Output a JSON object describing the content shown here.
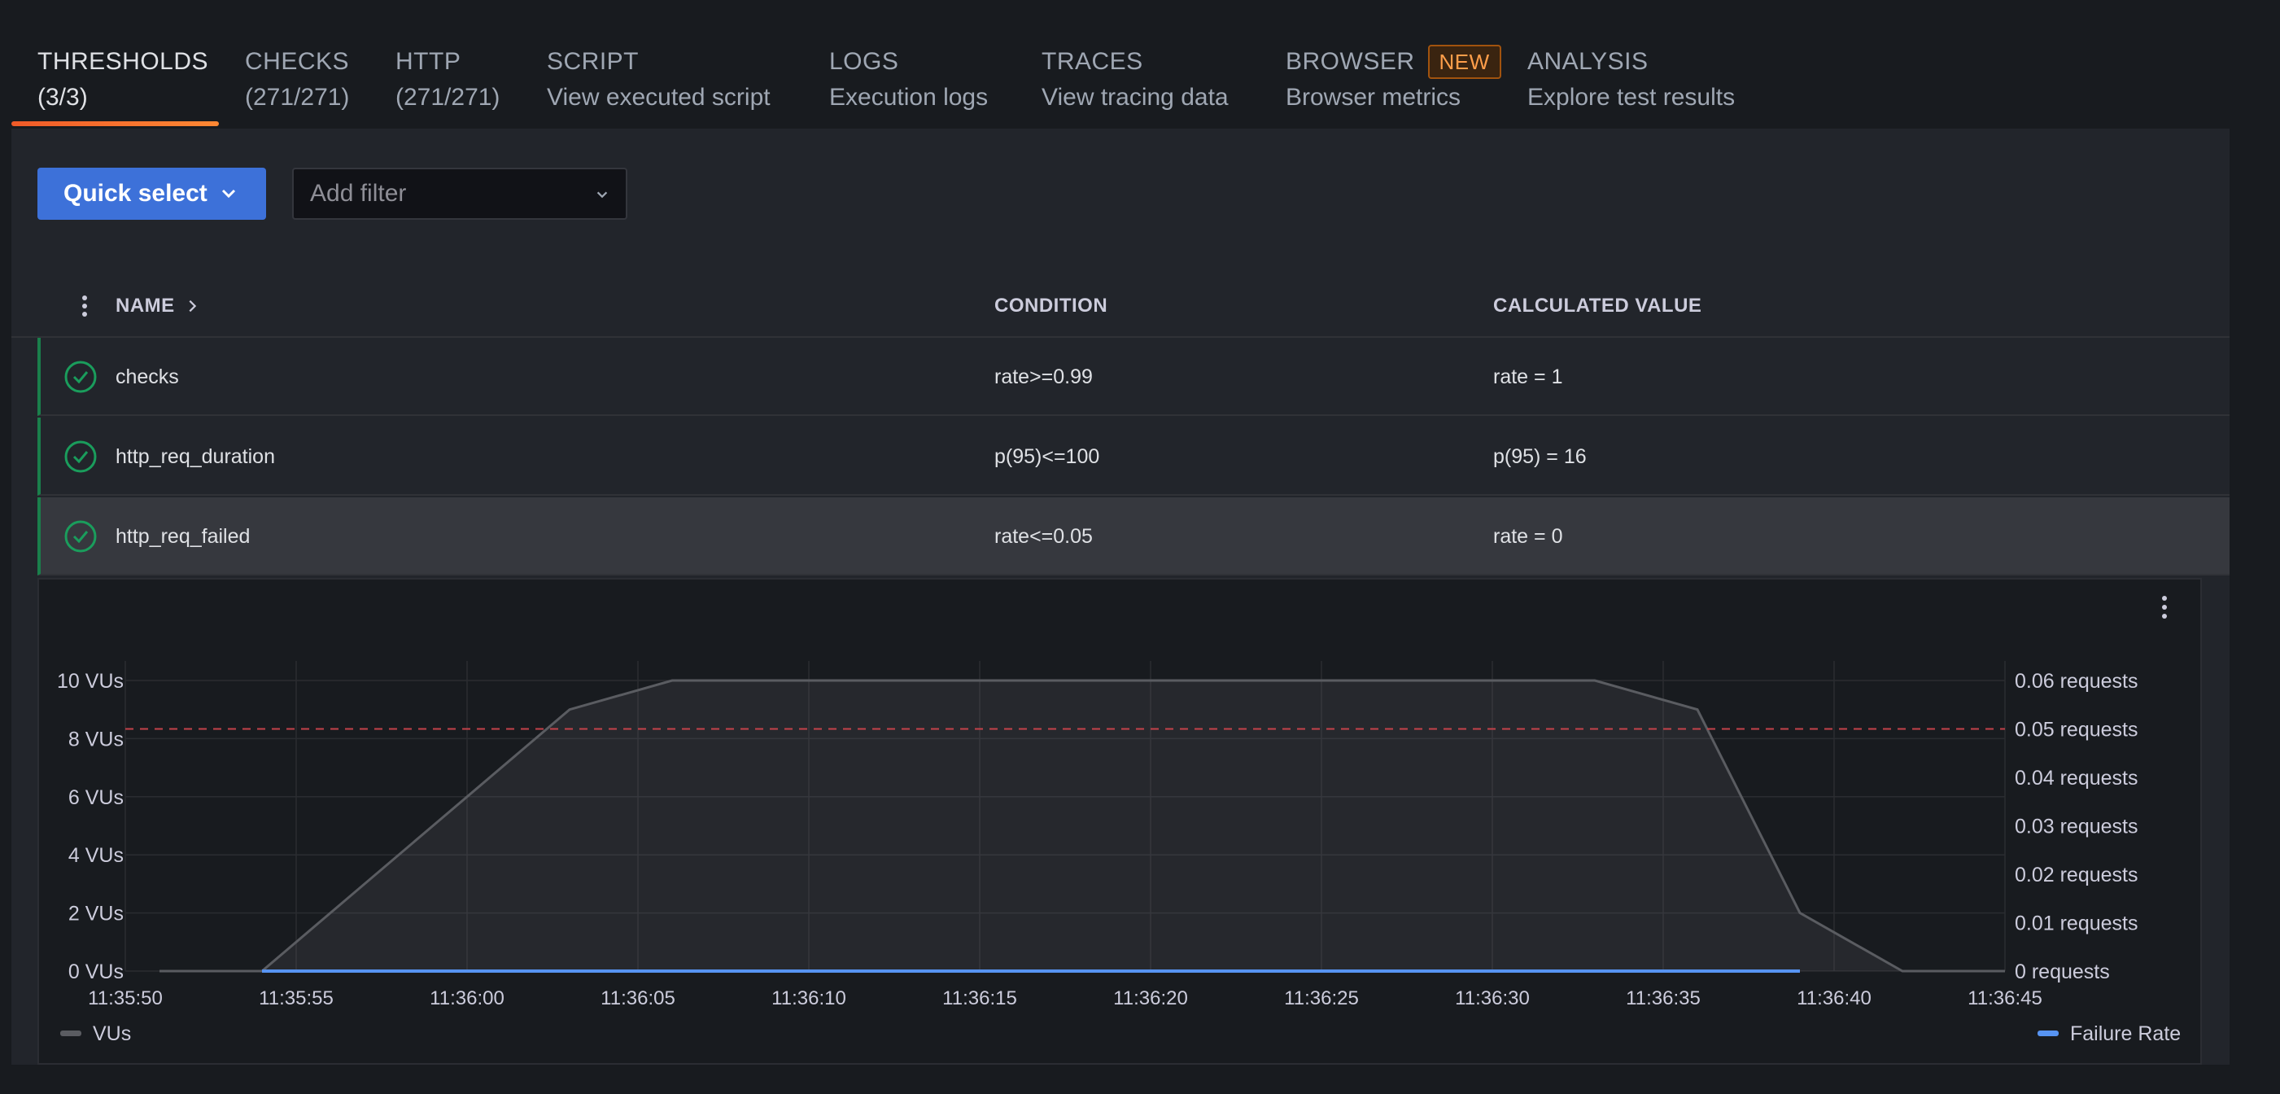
{
  "tabs": [
    {
      "label": "THRESHOLDS",
      "sub": "(3/3)"
    },
    {
      "label": "CHECKS",
      "sub": "(271/271)"
    },
    {
      "label": "HTTP",
      "sub": "(271/271)"
    },
    {
      "label": "SCRIPT",
      "sub": "View executed script"
    },
    {
      "label": "LOGS",
      "sub": "Execution logs"
    },
    {
      "label": "TRACES",
      "sub": "View tracing data"
    },
    {
      "label": "BROWSER",
      "sub": "Browser metrics",
      "badge": "NEW"
    },
    {
      "label": "ANALYSIS",
      "sub": "Explore test results"
    }
  ],
  "toolbar": {
    "quick_select": "Quick select",
    "filter_placeholder": "Add filter"
  },
  "table": {
    "headers": {
      "name": "NAME",
      "condition": "CONDITION",
      "value": "CALCULATED VALUE"
    },
    "rows": [
      {
        "name": "checks",
        "condition": "rate>=0.99",
        "value": "rate = 1"
      },
      {
        "name": "http_req_duration",
        "condition": "p(95)<=100",
        "value": "p(95) = 16"
      },
      {
        "name": "http_req_failed",
        "condition": "rate<=0.05",
        "value": "rate = 0"
      }
    ]
  },
  "colors": {
    "accent": "#3d71d9",
    "pass": "#1a7f4b",
    "vus_line": "#5a5c61",
    "failure_line": "#5794f2",
    "threshold": "#c4424a"
  },
  "chart_data": {
    "type": "line",
    "x_ticks": [
      "11:35:50",
      "11:35:55",
      "11:36:00",
      "11:36:05",
      "11:36:10",
      "11:36:15",
      "11:36:20",
      "11:36:25",
      "11:36:30",
      "11:36:35",
      "11:36:40",
      "11:36:45"
    ],
    "y_left_ticks": [
      "0 VUs",
      "2 VUs",
      "4 VUs",
      "6 VUs",
      "8 VUs",
      "10 VUs"
    ],
    "y_right_ticks": [
      "0 requests",
      "0.01 requests",
      "0.02 requests",
      "0.03 requests",
      "0.04 requests",
      "0.05 requests",
      "0.06 requests"
    ],
    "ylim_left": [
      0,
      10
    ],
    "ylim_right": [
      0,
      0.06
    ],
    "series": [
      {
        "name": "VUs",
        "axis": "left",
        "color": "#5a5c61",
        "x": [
          "11:35:51",
          "11:35:54",
          "11:36:03",
          "11:36:06",
          "11:36:33",
          "11:36:36",
          "11:36:39",
          "11:36:42",
          "11:36:45"
        ],
        "values": [
          0,
          0,
          9,
          10,
          10,
          9,
          2,
          0,
          0
        ]
      },
      {
        "name": "Failure Rate",
        "axis": "right",
        "color": "#5794f2",
        "x": [
          "11:35:54",
          "11:36:39"
        ],
        "values": [
          0,
          0
        ]
      }
    ],
    "threshold": 0.05,
    "grid": true,
    "legend": "bottom"
  }
}
